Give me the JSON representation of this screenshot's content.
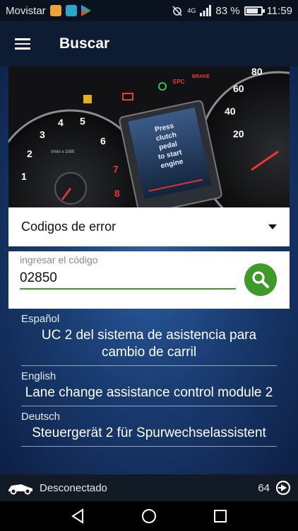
{
  "status_bar": {
    "carrier": "Movistar",
    "battery_text": "83 %",
    "battery_level": 0.83,
    "network": "4G",
    "time": "11:59"
  },
  "app_bar": {
    "title": "Buscar",
    "menu_icon": "hamburger-menu-icon"
  },
  "hero": {
    "dash_text_lines": [
      "Press",
      "clutch",
      "pedal",
      "to start",
      "engine"
    ],
    "left_gauge_label": "Vmin x 1000",
    "left_gauge_ticks": [
      "1",
      "2",
      "3",
      "4",
      "5",
      "6",
      "7",
      "8"
    ],
    "right_gauge_ticks": [
      "20",
      "40",
      "60",
      "80"
    ],
    "warning_labels": [
      "EPC",
      "BRAKE"
    ]
  },
  "dropdown": {
    "selected": "Codigos de error"
  },
  "search": {
    "label": "ingresar el código",
    "value": "02850",
    "icon": "search-icon",
    "accent": "#3f9a2b"
  },
  "results": [
    {
      "language": "Español",
      "description": "UC 2 del sistema de asistencia para cambio de carril"
    },
    {
      "language": "English",
      "description": "Lane change assistance control module 2"
    },
    {
      "language": "Deutsch",
      "description": "Steuergerät 2 für Spurwechselassistent"
    }
  ],
  "connection": {
    "status": "Desconectado",
    "count": "64",
    "car_icon": "car-icon",
    "arrow_icon": "circle-arrow-icon"
  },
  "nav": {
    "back_icon": "back-triangle-icon",
    "home_icon": "home-circle-icon",
    "recents_icon": "recents-square-icon"
  }
}
